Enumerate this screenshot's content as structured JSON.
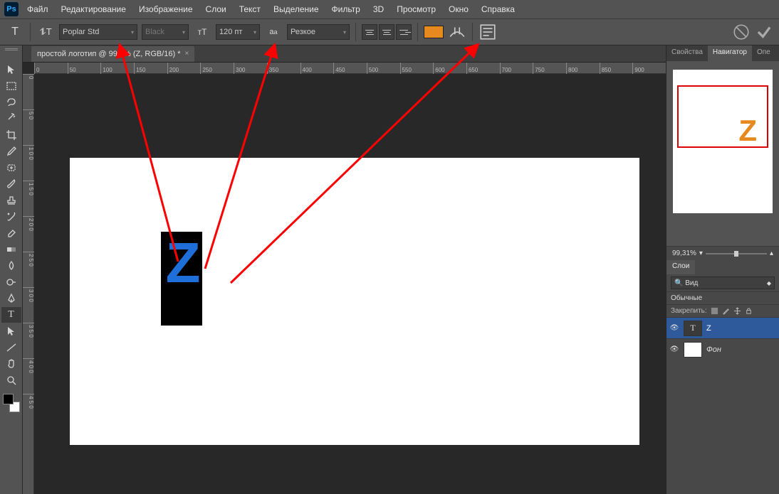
{
  "app": {
    "logo": "Ps"
  },
  "menu": {
    "file": "Файл",
    "edit": "Редактирование",
    "image": "Изображение",
    "layer": "Слои",
    "text": "Текст",
    "select": "Выделение",
    "filter": "Фильтр",
    "d3": "3D",
    "view": "Просмотр",
    "window": "Окно",
    "help": "Справка"
  },
  "opt": {
    "font_name": "Poplar Std",
    "font_style": "Black",
    "font_size": "120 пт",
    "aa_label": "Резкое",
    "color": "#e68a1f"
  },
  "doc": {
    "tab_title": "простой логотип @ 99,3% (Z, RGB/16) *",
    "hruler": [
      "0",
      "50",
      "100",
      "150",
      "200",
      "250",
      "300",
      "350",
      "400",
      "450",
      "500",
      "550",
      "600",
      "650",
      "700",
      "750",
      "800",
      "850",
      "900"
    ],
    "vruler": [
      "0",
      "5 0",
      "1 0 0",
      "1 5 0",
      "2 0 0",
      "2 5 0",
      "3 0 0",
      "3 5 0",
      "4 0 0",
      "4 5 0"
    ],
    "text_char": "Z"
  },
  "nav": {
    "tab_props": "Свойства",
    "tab_nav": "Навигатор",
    "tab_ops": "Опе",
    "zoom": "99,31%",
    "mini": "Z"
  },
  "layers": {
    "title": "Слои",
    "blend_prefix": "🔍",
    "blend_label": "Вид",
    "mode": "Обычные",
    "lock_label": "Закрепить:",
    "items": [
      {
        "name": "Z",
        "type": "text"
      },
      {
        "name": "Фон",
        "type": "bg"
      }
    ]
  }
}
